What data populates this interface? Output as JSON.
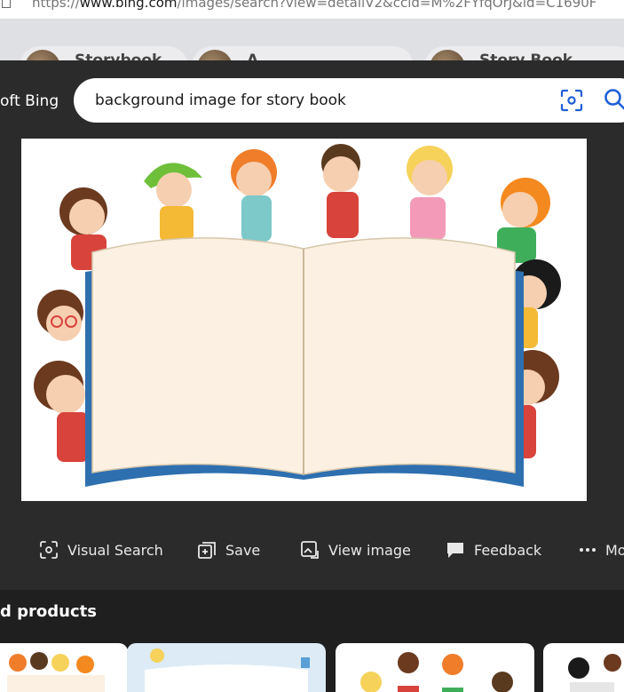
{
  "browser": {
    "url_prefix": "https://",
    "url_host": "www.bing.com",
    "url_path": "/images/search?view=detailV2&ccid=M%2FYfqOrJ&id=C1690F"
  },
  "background_page": {
    "chips": [
      "Storybook",
      "A",
      "Story Book"
    ]
  },
  "header": {
    "brand": "oft Bing"
  },
  "search": {
    "query": "background image for story book"
  },
  "actions": {
    "visual_search": "Visual Search",
    "save": "Save",
    "view_image": "View image",
    "feedback": "Feedback",
    "more": "Mo"
  },
  "related": {
    "heading": "d products"
  },
  "colors": {
    "overlay_bg": "#2b2b2b",
    "accent_blue": "#1e5fd6",
    "book_page": "#fbf0e1",
    "book_cover": "#2e6fb0"
  }
}
